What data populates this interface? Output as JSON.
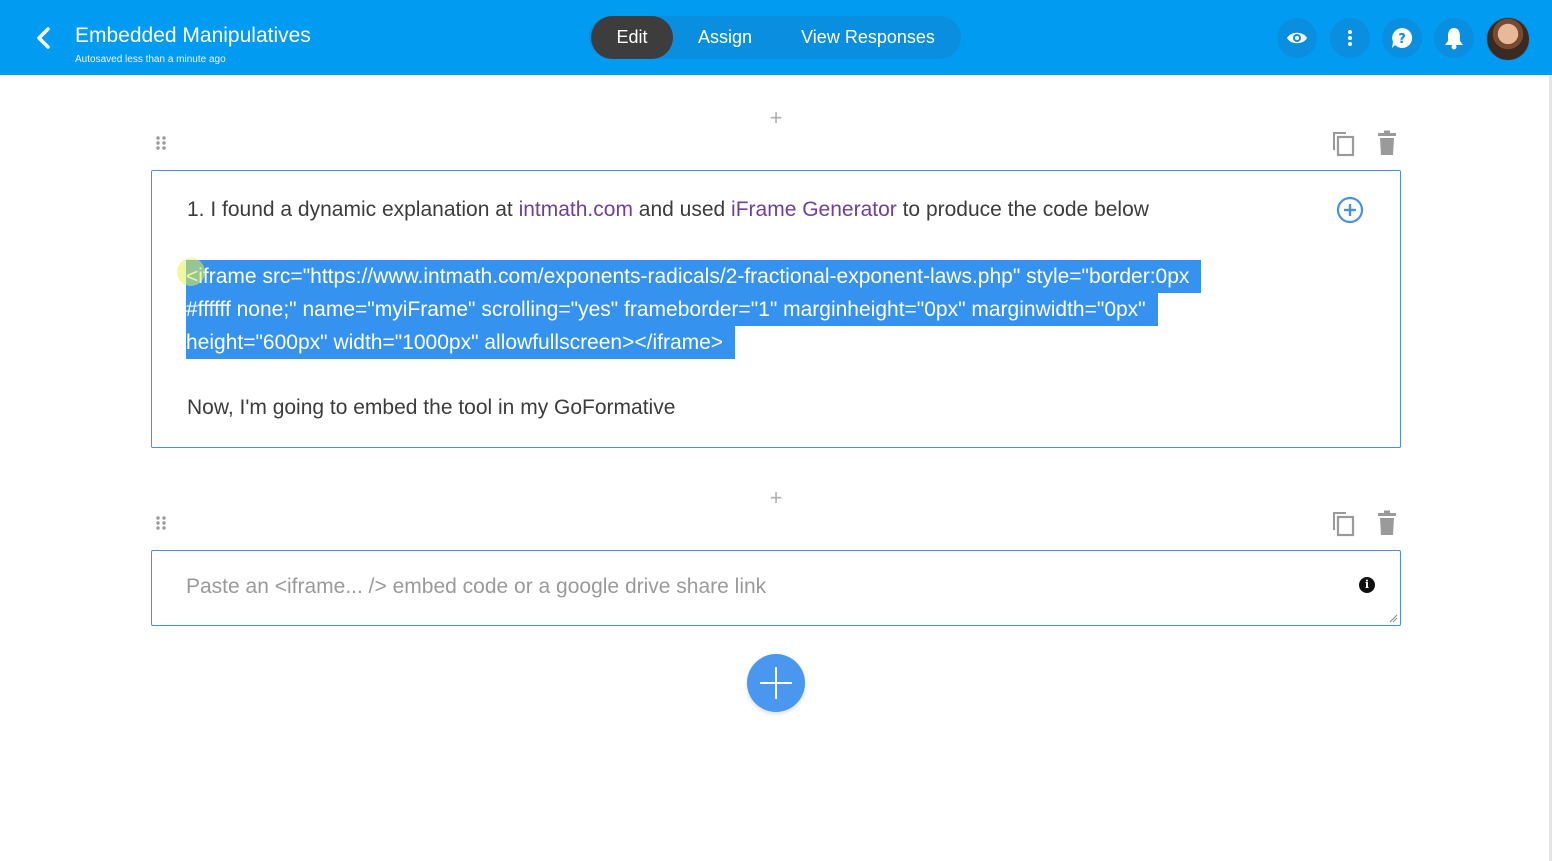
{
  "header": {
    "title": "Embedded Manipulatives",
    "subtitle": "Autosaved less than a minute ago",
    "tabs": [
      {
        "label": "Edit",
        "active": true
      },
      {
        "label": "Assign",
        "active": false
      },
      {
        "label": "View Responses",
        "active": false
      }
    ],
    "icons": [
      "chevron-left-icon",
      "eye-icon",
      "more-vertical-icon",
      "help-chat-icon",
      "bell-icon"
    ],
    "accent_color": "#029bf2"
  },
  "question1": {
    "line1_prefix": "1. I found a dynamic explanation at ",
    "link1": "intmath.com",
    "line1_middle": " and used ",
    "link2": "iFrame Generator",
    "line1_suffix": " to produce the code below",
    "code_line1": "<iframe src=\"https://www.intmath.com/exponents-radicals/2-fractional-exponent-laws.php\" style=\"border:0px",
    "code_line2": "#ffffff none;\" name=\"myiFrame\" scrolling=\"yes\" frameborder=\"1\" marginheight=\"0px\" marginwidth=\"0px\"",
    "code_line3": "height=\"600px\" width=\"1000px\" allowfullscreen></iframe>",
    "line4": "Now, I'm going to embed the tool in my GoFormative"
  },
  "question2": {
    "placeholder": "Paste an <iframe... /> embed code or a google drive share link",
    "info_icon_glyph": "i"
  },
  "controls": {
    "insert_glyph": "+"
  }
}
